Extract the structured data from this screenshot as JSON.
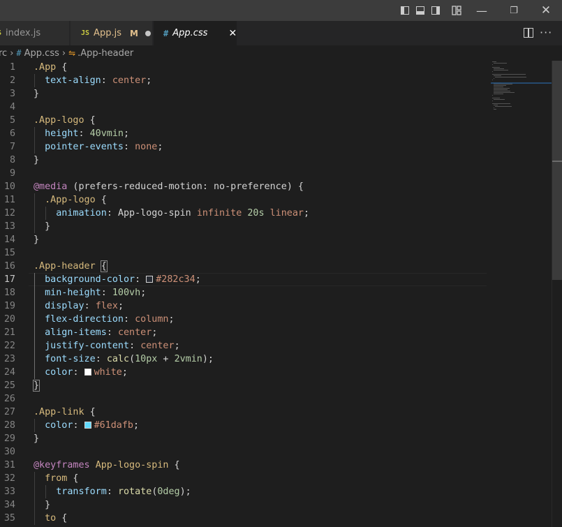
{
  "window_controls": {
    "layout_icons": [
      "toggle-primary-sidebar-icon",
      "toggle-panel-icon",
      "toggle-secondary-sidebar-icon",
      "customize-layout-icon"
    ],
    "minimize": "—",
    "restore": "❐",
    "close": "✕"
  },
  "tabs": [
    {
      "icon": "JS",
      "label": "index.js",
      "active": false,
      "modified": false
    },
    {
      "icon": "JS",
      "label": "App.js",
      "modified_label": "M",
      "active": false,
      "modified": true
    },
    {
      "icon": "#",
      "label": "App.css",
      "close": "✕",
      "active": true,
      "modified": false
    }
  ],
  "editor_actions": {
    "split": "split-editor-icon",
    "more": "···"
  },
  "breadcrumb": {
    "folder": "src",
    "file": "App.css",
    "symbol": ".App-header"
  },
  "colors": {
    "accent_js": "#cbcb41",
    "css_icon": "#519aba",
    "swatch_bg": "#282c34",
    "swatch_white": "#ffffff",
    "swatch_link": "#61dafb"
  },
  "code": {
    "current_line": "17",
    "lines": [
      {
        "n": "1",
        "tokens": [
          {
            "t": ".App",
            "c": "sel"
          },
          {
            "t": " {",
            "c": "punc"
          }
        ]
      },
      {
        "n": "2",
        "tokens": [
          {
            "t": "  text-align",
            "c": "prop"
          },
          {
            "t": ": ",
            "c": "punc"
          },
          {
            "t": "center",
            "c": "val"
          },
          {
            "t": ";",
            "c": "punc"
          }
        ]
      },
      {
        "n": "3",
        "tokens": [
          {
            "t": "}",
            "c": "punc"
          }
        ]
      },
      {
        "n": "4",
        "tokens": []
      },
      {
        "n": "5",
        "tokens": [
          {
            "t": ".App-logo",
            "c": "sel"
          },
          {
            "t": " {",
            "c": "punc"
          }
        ]
      },
      {
        "n": "6",
        "tokens": [
          {
            "t": "  height",
            "c": "prop"
          },
          {
            "t": ": ",
            "c": "punc"
          },
          {
            "t": "40vmin",
            "c": "num"
          },
          {
            "t": ";",
            "c": "punc"
          }
        ]
      },
      {
        "n": "7",
        "tokens": [
          {
            "t": "  pointer-events",
            "c": "prop"
          },
          {
            "t": ": ",
            "c": "punc"
          },
          {
            "t": "none",
            "c": "val"
          },
          {
            "t": ";",
            "c": "punc"
          }
        ]
      },
      {
        "n": "8",
        "tokens": [
          {
            "t": "}",
            "c": "punc"
          }
        ]
      },
      {
        "n": "9",
        "tokens": []
      },
      {
        "n": "10",
        "tokens": [
          {
            "t": "@media",
            "c": "at"
          },
          {
            "t": " (",
            "c": "punc"
          },
          {
            "t": "prefers-reduced-motion",
            "c": "punc"
          },
          {
            "t": ": ",
            "c": "punc"
          },
          {
            "t": "no-preference",
            "c": "punc"
          },
          {
            "t": ") {",
            "c": "punc"
          }
        ]
      },
      {
        "n": "11",
        "tokens": [
          {
            "t": "  .App-logo",
            "c": "sel"
          },
          {
            "t": " {",
            "c": "punc"
          }
        ]
      },
      {
        "n": "12",
        "tokens": [
          {
            "t": "    animation",
            "c": "prop"
          },
          {
            "t": ": ",
            "c": "punc"
          },
          {
            "t": "App-logo-spin ",
            "c": "punc"
          },
          {
            "t": "infinite ",
            "c": "val"
          },
          {
            "t": "20s ",
            "c": "num"
          },
          {
            "t": "linear",
            "c": "val"
          },
          {
            "t": ";",
            "c": "punc"
          }
        ]
      },
      {
        "n": "13",
        "tokens": [
          {
            "t": "  }",
            "c": "punc"
          }
        ]
      },
      {
        "n": "14",
        "tokens": [
          {
            "t": "}",
            "c": "punc"
          }
        ]
      },
      {
        "n": "15",
        "tokens": []
      },
      {
        "n": "16",
        "tokens": [
          {
            "t": ".App-header",
            "c": "sel"
          },
          {
            "t": " ",
            "c": "punc"
          },
          {
            "t": "{",
            "c": "punc bm"
          }
        ]
      },
      {
        "n": "17",
        "tokens": [
          {
            "t": "  background-color",
            "c": "prop"
          },
          {
            "t": ": ",
            "c": "punc"
          },
          {
            "swatch": "#282c34"
          },
          {
            "t": "#282c34",
            "c": "val"
          },
          {
            "t": ";",
            "c": "punc"
          }
        ]
      },
      {
        "n": "18",
        "tokens": [
          {
            "t": "  min-height",
            "c": "prop"
          },
          {
            "t": ": ",
            "c": "punc"
          },
          {
            "t": "100vh",
            "c": "num"
          },
          {
            "t": ";",
            "c": "punc"
          }
        ]
      },
      {
        "n": "19",
        "tokens": [
          {
            "t": "  display",
            "c": "prop"
          },
          {
            "t": ": ",
            "c": "punc"
          },
          {
            "t": "flex",
            "c": "val"
          },
          {
            "t": ";",
            "c": "punc"
          }
        ]
      },
      {
        "n": "20",
        "tokens": [
          {
            "t": "  flex-direction",
            "c": "prop"
          },
          {
            "t": ": ",
            "c": "punc"
          },
          {
            "t": "column",
            "c": "val"
          },
          {
            "t": ";",
            "c": "punc"
          }
        ]
      },
      {
        "n": "21",
        "tokens": [
          {
            "t": "  align-items",
            "c": "prop"
          },
          {
            "t": ": ",
            "c": "punc"
          },
          {
            "t": "center",
            "c": "val"
          },
          {
            "t": ";",
            "c": "punc"
          }
        ]
      },
      {
        "n": "22",
        "tokens": [
          {
            "t": "  justify-content",
            "c": "prop"
          },
          {
            "t": ": ",
            "c": "punc"
          },
          {
            "t": "center",
            "c": "val"
          },
          {
            "t": ";",
            "c": "punc"
          }
        ]
      },
      {
        "n": "23",
        "tokens": [
          {
            "t": "  font-size",
            "c": "prop"
          },
          {
            "t": ": ",
            "c": "punc"
          },
          {
            "t": "calc",
            "c": "fn"
          },
          {
            "t": "(",
            "c": "punc"
          },
          {
            "t": "10px",
            "c": "num"
          },
          {
            "t": " + ",
            "c": "punc"
          },
          {
            "t": "2vmin",
            "c": "num"
          },
          {
            "t": ");",
            "c": "punc"
          }
        ]
      },
      {
        "n": "24",
        "tokens": [
          {
            "t": "  color",
            "c": "prop"
          },
          {
            "t": ": ",
            "c": "punc"
          },
          {
            "swatch": "#ffffff"
          },
          {
            "t": "white",
            "c": "val"
          },
          {
            "t": ";",
            "c": "punc"
          }
        ]
      },
      {
        "n": "25",
        "tokens": [
          {
            "t": "}",
            "c": "punc bm"
          }
        ]
      },
      {
        "n": "26",
        "tokens": []
      },
      {
        "n": "27",
        "tokens": [
          {
            "t": ".App-link",
            "c": "sel"
          },
          {
            "t": " {",
            "c": "punc"
          }
        ]
      },
      {
        "n": "28",
        "tokens": [
          {
            "t": "  color",
            "c": "prop"
          },
          {
            "t": ": ",
            "c": "punc"
          },
          {
            "swatch": "#61dafb"
          },
          {
            "t": "#61dafb",
            "c": "val"
          },
          {
            "t": ";",
            "c": "punc"
          }
        ]
      },
      {
        "n": "29",
        "tokens": [
          {
            "t": "}",
            "c": "punc"
          }
        ]
      },
      {
        "n": "30",
        "tokens": []
      },
      {
        "n": "31",
        "tokens": [
          {
            "t": "@keyframes",
            "c": "at"
          },
          {
            "t": " ",
            "c": "punc"
          },
          {
            "t": "App-logo-spin",
            "c": "kf"
          },
          {
            "t": " {",
            "c": "punc"
          }
        ]
      },
      {
        "n": "32",
        "tokens": [
          {
            "t": "  from",
            "c": "sel"
          },
          {
            "t": " {",
            "c": "punc"
          }
        ]
      },
      {
        "n": "33",
        "tokens": [
          {
            "t": "    transform",
            "c": "prop"
          },
          {
            "t": ": ",
            "c": "punc"
          },
          {
            "t": "rotate",
            "c": "fn"
          },
          {
            "t": "(",
            "c": "punc"
          },
          {
            "t": "0deg",
            "c": "num"
          },
          {
            "t": ");",
            "c": "punc"
          }
        ]
      },
      {
        "n": "34",
        "tokens": [
          {
            "t": "  }",
            "c": "punc"
          }
        ]
      },
      {
        "n": "35",
        "tokens": [
          {
            "t": "  to",
            "c": "sel"
          },
          {
            "t": " {",
            "c": "punc"
          }
        ]
      }
    ]
  },
  "scrollbar": {
    "visible_fraction": 0.47
  }
}
